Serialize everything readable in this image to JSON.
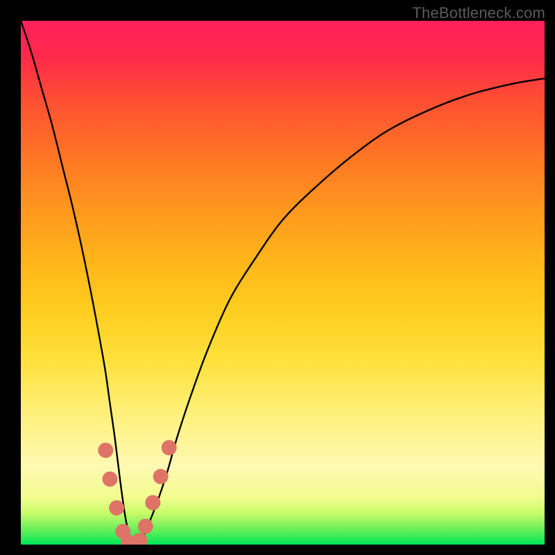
{
  "attribution": "TheBottleneck.com",
  "colors": {
    "marker": "#de7468",
    "curve": "#000000"
  },
  "chart_data": {
    "type": "line",
    "title": "",
    "xlabel": "",
    "ylabel": "",
    "xlim": [
      0,
      100
    ],
    "ylim": [
      0,
      100
    ],
    "x": [
      0,
      2,
      4,
      6,
      8,
      10,
      12,
      14,
      16,
      17,
      18,
      19,
      20,
      21,
      22,
      23,
      24,
      26,
      28,
      30,
      33,
      36,
      40,
      45,
      50,
      56,
      63,
      70,
      78,
      86,
      94,
      100
    ],
    "values": [
      100,
      94,
      87,
      80,
      72,
      64,
      55,
      45,
      34,
      27,
      20,
      12,
      5,
      1,
      0,
      1,
      3,
      8,
      14,
      21,
      30,
      38,
      47,
      55,
      62,
      68,
      74,
      79,
      83,
      86,
      88,
      89
    ],
    "series": [
      {
        "name": "bottleneck-curve",
        "x": [
          0,
          2,
          4,
          6,
          8,
          10,
          12,
          14,
          16,
          17,
          18,
          19,
          20,
          21,
          22,
          23,
          24,
          26,
          28,
          30,
          33,
          36,
          40,
          45,
          50,
          56,
          63,
          70,
          78,
          86,
          94,
          100
        ],
        "y": [
          100,
          94,
          87,
          80,
          72,
          64,
          55,
          45,
          34,
          27,
          20,
          12,
          5,
          1,
          0,
          1,
          3,
          8,
          14,
          21,
          30,
          38,
          47,
          55,
          62,
          68,
          74,
          79,
          83,
          86,
          88,
          89
        ]
      }
    ],
    "markers": [
      {
        "x": 16.2,
        "y": 18.0
      },
      {
        "x": 17.0,
        "y": 12.5
      },
      {
        "x": 18.3,
        "y": 7.0
      },
      {
        "x": 19.5,
        "y": 2.5
      },
      {
        "x": 20.5,
        "y": 0.5
      },
      {
        "x": 21.5,
        "y": 0.0
      },
      {
        "x": 22.7,
        "y": 0.8
      },
      {
        "x": 23.8,
        "y": 3.5
      },
      {
        "x": 25.2,
        "y": 8.0
      },
      {
        "x": 26.7,
        "y": 13.0
      },
      {
        "x": 28.3,
        "y": 18.5
      }
    ]
  }
}
